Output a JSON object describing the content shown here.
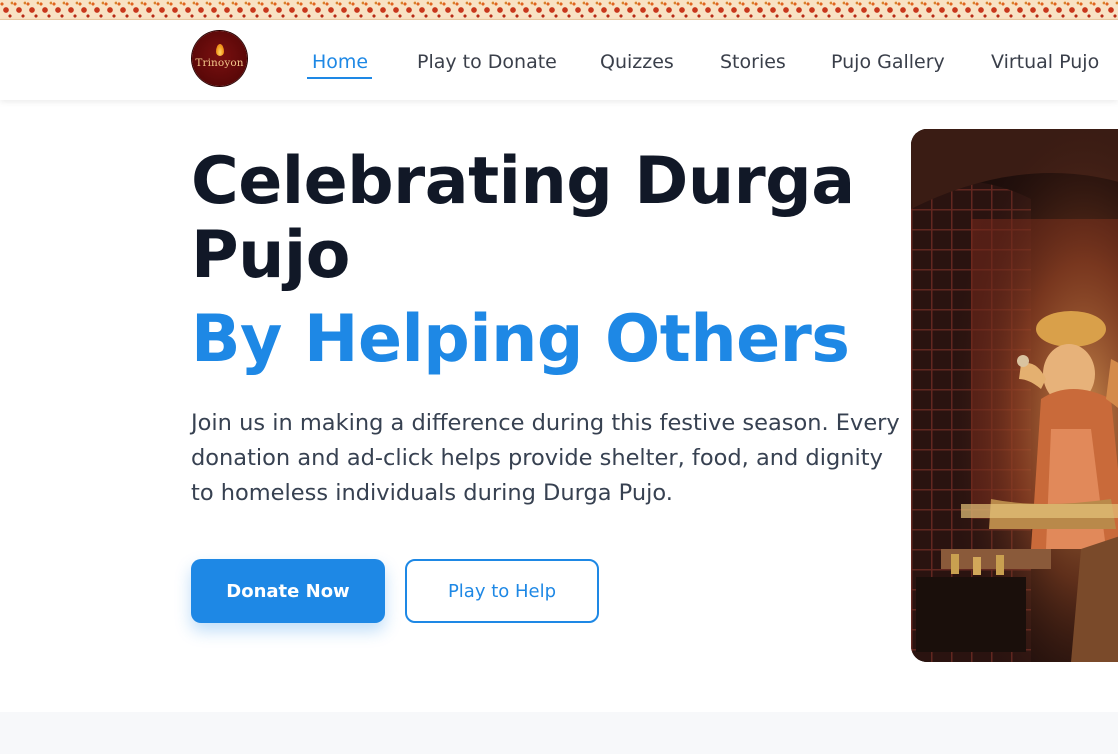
{
  "brand": {
    "logo_text": "Trinoyon"
  },
  "nav": {
    "items": [
      {
        "label": "Home",
        "active": true
      },
      {
        "label": "Play to Donate",
        "active": false
      },
      {
        "label": "Quizzes",
        "active": false
      },
      {
        "label": "Stories",
        "active": false
      },
      {
        "label": "Pujo Gallery",
        "active": false
      },
      {
        "label": "Virtual Pujo",
        "active": false
      }
    ]
  },
  "hero": {
    "title": "Celebrating Durga Pujo",
    "title_accent": "By Helping Others",
    "description": "Join us in making a difference during this festive season. Every donation and ad-click helps provide shelter, food, and dignity to homeless individuals during Durga Pujo.",
    "primary_button": "Donate Now",
    "secondary_button": "Play to Help",
    "image_icon": "durga-idol-photo"
  },
  "colors": {
    "accent": "#1e88e5",
    "heading": "#111827",
    "body_text": "#374151",
    "logo_bg": "#5a0808"
  }
}
